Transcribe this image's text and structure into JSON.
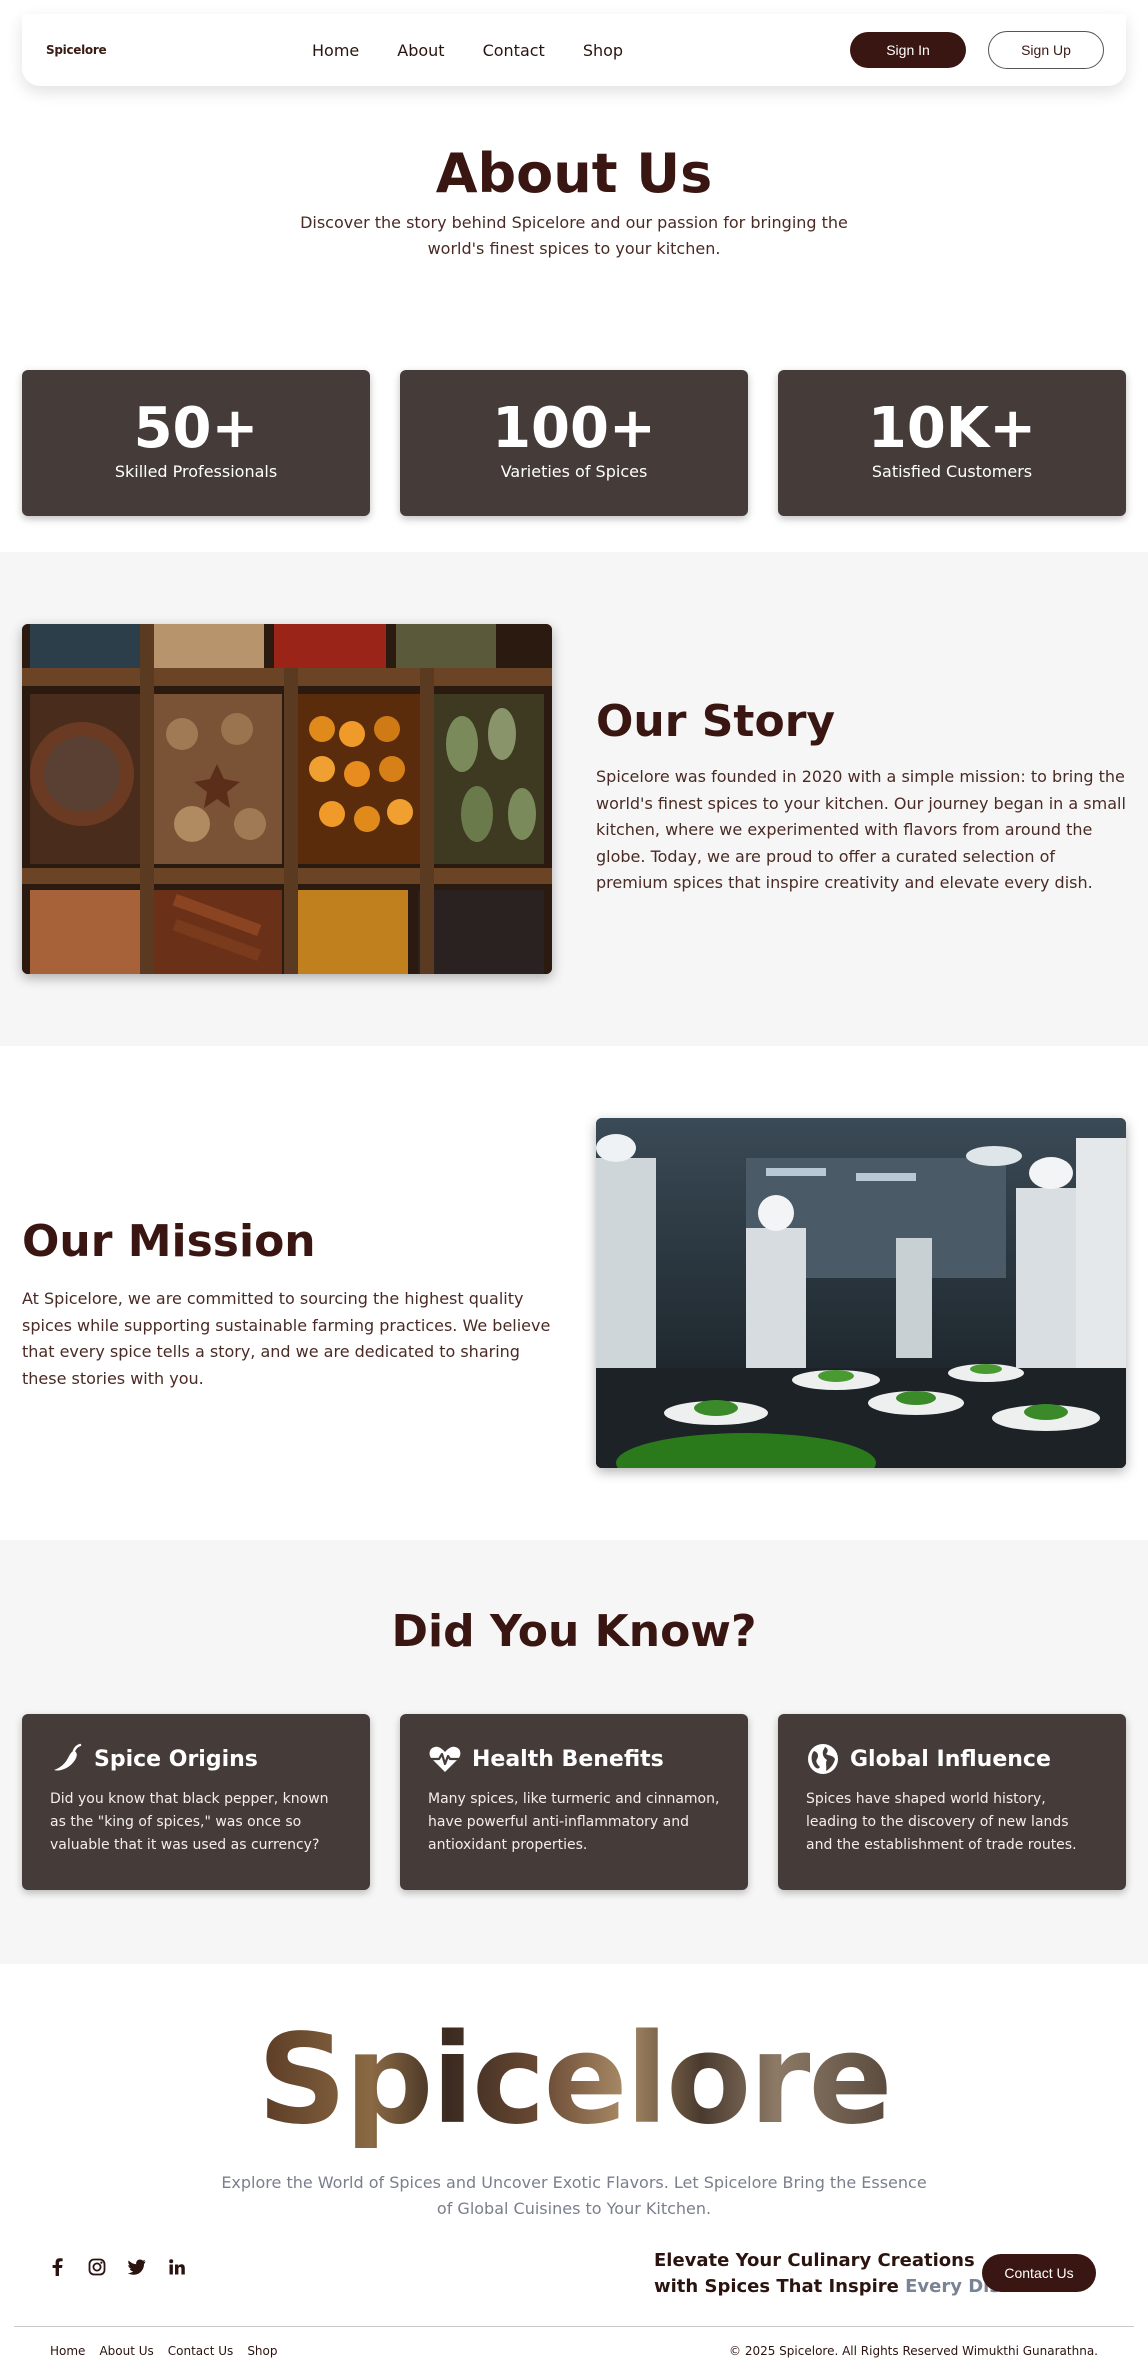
{
  "header": {
    "logo": "Spicelore",
    "nav": [
      "Home",
      "About",
      "Contact",
      "Shop"
    ],
    "signin_label": "Sign In",
    "signup_label": "Sign Up"
  },
  "hero": {
    "title": "About Us",
    "subtitle": "Discover the story behind Spicelore and our passion for bringing the world's finest spices to your kitchen."
  },
  "stats": [
    {
      "value": "50+",
      "label": "Skilled Professionals"
    },
    {
      "value": "100+",
      "label": "Varieties of Spices"
    },
    {
      "value": "10K+",
      "label": "Satisfied Customers"
    }
  ],
  "story": {
    "title": "Our Story",
    "text": "Spicelore was founded in 2020 with a simple mission: to bring the world's finest spices to your kitchen. Our journey began in a small kitchen, where we experimented with flavors from around the globe. Today, we are proud to offer a curated selection of premium spices that inspire creativity and elevate every dish."
  },
  "mission": {
    "title": "Our Mission",
    "text": "At Spicelore, we are committed to sourcing the highest quality spices while supporting sustainable farming practices. We believe that every spice tells a story, and we are dedicated to sharing these stories with you."
  },
  "facts": {
    "title": "Did You Know?",
    "items": [
      {
        "icon": "pepper-icon",
        "title": "Spice Origins",
        "text": "Did you know that black pepper, known as the \"king of spices,\" was once so valuable that it was used as currency?"
      },
      {
        "icon": "heart-pulse-icon",
        "title": "Health Benefits",
        "text": "Many spices, like turmeric and cinnamon, have powerful anti-inflammatory and antioxidant properties."
      },
      {
        "icon": "globe-icon",
        "title": "Global Influence",
        "text": "Spices have shaped world history, leading to the discovery of new lands and the establishment of trade routes."
      }
    ]
  },
  "footer": {
    "brand": "Spicelore",
    "tagline": "Explore the World of Spices and Uncover Exotic Flavors. Let Spicelore Bring the Essence of Global Cuisines to Your Kitchen.",
    "socials": [
      "facebook-icon",
      "instagram-icon",
      "twitter-icon",
      "linkedin-icon"
    ],
    "cta_line1": "Elevate Your Culinary Creations",
    "cta_line2": "with Spices That Inspire ",
    "cta_accent": "Every Dish",
    "contact_label": "Contact Us",
    "links": [
      "Home",
      "About Us",
      "Contact Us",
      "Shop"
    ],
    "copyright": "© 2025 Spicelore. All Rights Reserved Wimukthi Gunarathna."
  },
  "colors": {
    "primary": "#3a1612",
    "card": "#453c39",
    "section_bg": "#f6f6f6",
    "accent_text": "#7a8394"
  }
}
